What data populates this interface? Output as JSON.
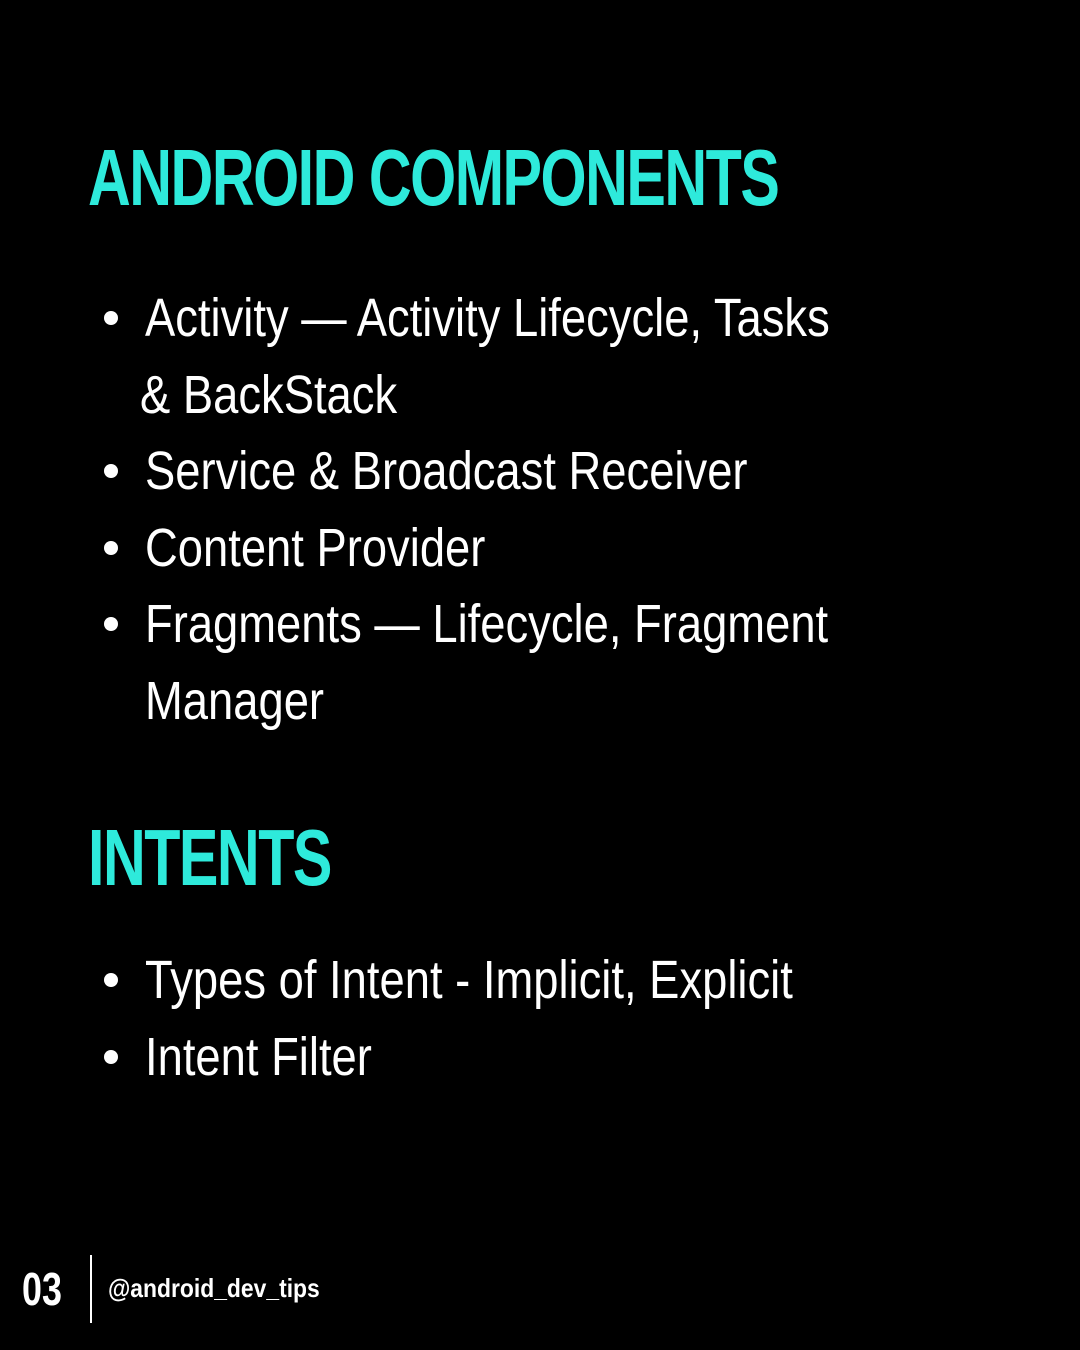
{
  "colors": {
    "background": "#000000",
    "heading": "#2eeadb",
    "text": "#ffffff"
  },
  "sections": [
    {
      "heading": "ANDROID COMPONENTS",
      "items": [
        "Activity — Activity Lifecycle, Tasks",
        "& BackStack",
        "Service & Broadcast Receiver",
        "Content Provider",
        "Fragments — Lifecycle, Fragment",
        "Manager"
      ]
    },
    {
      "heading": "INTENTS",
      "items": [
        "Types of Intent - Implicit, Explicit",
        "Intent Filter"
      ]
    }
  ],
  "footer": {
    "page_number": "03",
    "handle": "@android_dev_tips"
  }
}
